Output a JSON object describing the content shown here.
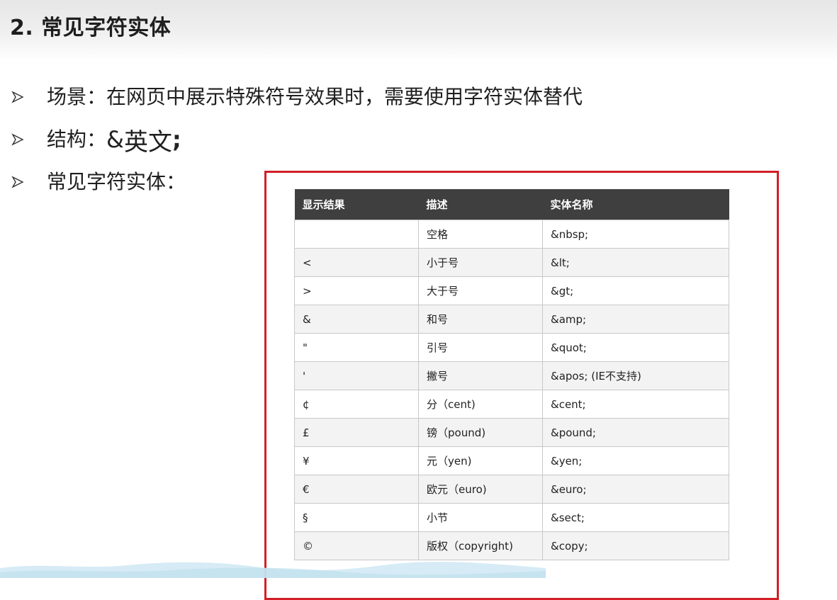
{
  "page": {
    "title": "2. 常见字符实体"
  },
  "bullets": {
    "scene": "场景：在网页中展示特殊符号效果时，需要使用字符实体替代",
    "structure_label": "结构：",
    "structure_amp": "&",
    "structure_value": "英文",
    "structure_semicolon": ";",
    "common_label": "常见字符实体："
  },
  "table": {
    "headers": [
      "显示结果",
      "描述",
      "实体名称"
    ],
    "rows": [
      {
        "display": "",
        "desc": "空格",
        "entity": "&nbsp;"
      },
      {
        "display": "<",
        "desc": "小于号",
        "entity": "&lt;"
      },
      {
        "display": ">",
        "desc": "大于号",
        "entity": "&gt;"
      },
      {
        "display": "&",
        "desc": "和号",
        "entity": "&amp;"
      },
      {
        "display": "\"",
        "desc": "引号",
        "entity": "&quot;"
      },
      {
        "display": "'",
        "desc": "撇号",
        "entity": "&apos; (IE不支持)"
      },
      {
        "display": "¢",
        "desc": "分（cent)",
        "entity": "&cent;"
      },
      {
        "display": "£",
        "desc": "镑（pound)",
        "entity": "&pound;"
      },
      {
        "display": "¥",
        "desc": "元（yen)",
        "entity": "&yen;"
      },
      {
        "display": "€",
        "desc": "欧元（euro)",
        "entity": "&euro;"
      },
      {
        "display": "§",
        "desc": "小节",
        "entity": "&sect;"
      },
      {
        "display": "©",
        "desc": "版权（copyright)",
        "entity": "&copy;"
      }
    ]
  },
  "colors": {
    "frame_border": "#d21f26",
    "table_header_bg": "#3f3f3f",
    "wave": "#cfe8f3"
  },
  "icons": {
    "bullet": "arrow-bullet-icon"
  }
}
